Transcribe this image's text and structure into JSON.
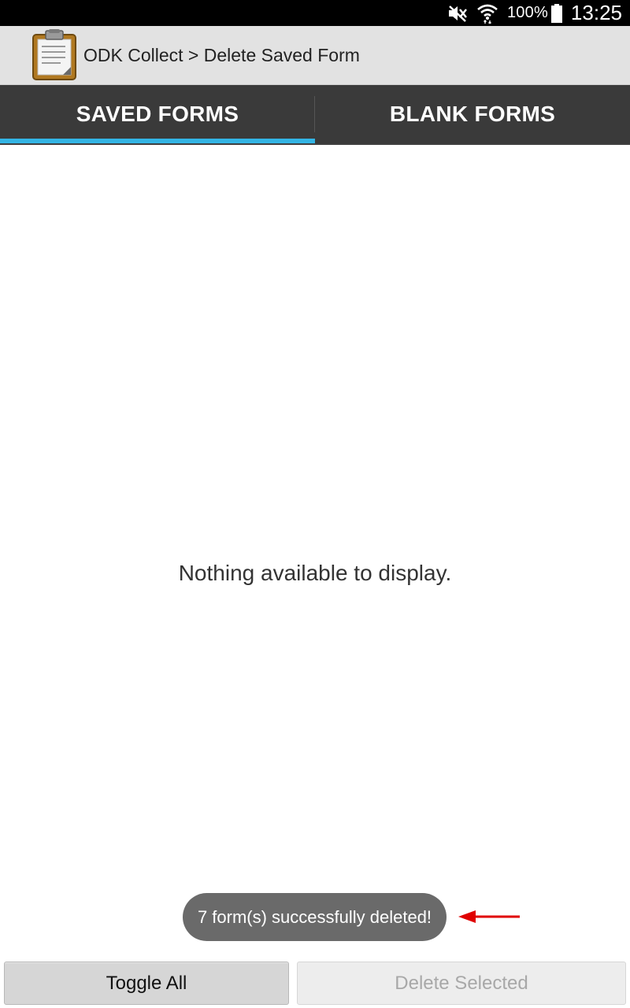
{
  "status_bar": {
    "battery_percent": "100%",
    "time": "13:25",
    "icons": [
      "mute-icon",
      "wifi-icon",
      "battery-icon"
    ]
  },
  "action_bar": {
    "app_icon": "clipboard-icon",
    "title": "ODK Collect > Delete Saved Form"
  },
  "tabs": [
    {
      "label": "SAVED FORMS",
      "selected": true
    },
    {
      "label": "BLANK FORMS",
      "selected": false
    }
  ],
  "content": {
    "empty_message": "Nothing available to display."
  },
  "toast": {
    "message": "7 form(s) successfully deleted!"
  },
  "buttons": {
    "toggle_all": "Toggle All",
    "delete_selected": "Delete Selected",
    "delete_selected_enabled": false
  },
  "colors": {
    "tab_indicator": "#33b5e5",
    "tab_bar": "#3a3a3a",
    "action_bar": "#e2e2e2",
    "annotation_arrow": "#e00000"
  }
}
